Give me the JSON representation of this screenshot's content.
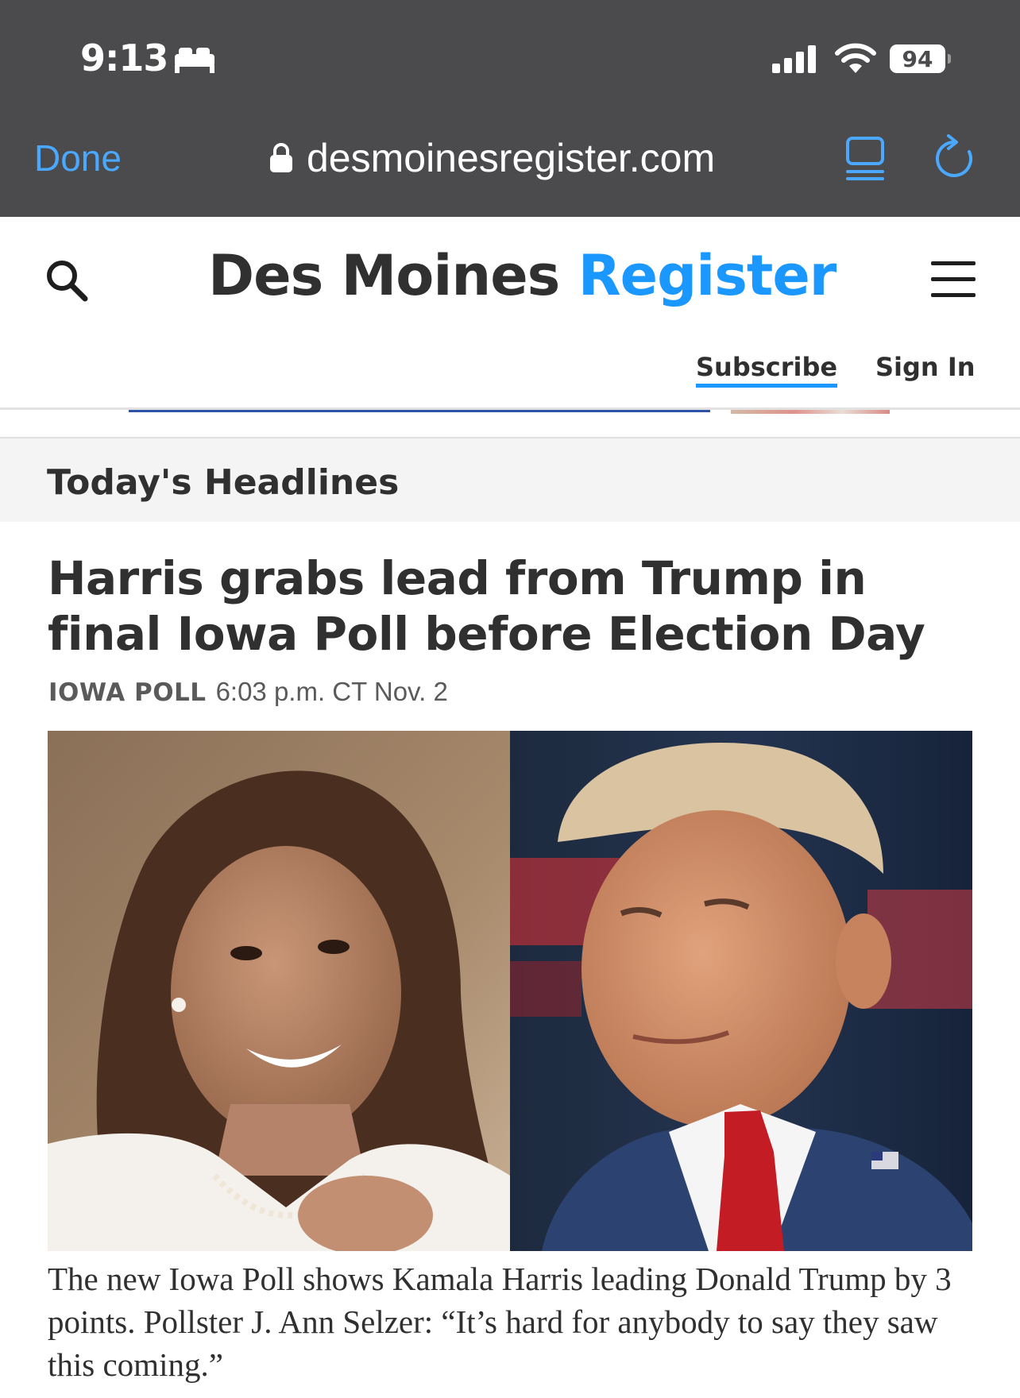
{
  "status_bar": {
    "time": "9:13",
    "battery": "94",
    "icons": [
      "bed-icon",
      "signal-bars-icon",
      "wifi-icon",
      "battery-icon"
    ]
  },
  "browser": {
    "done_label": "Done",
    "url": "desmoinesregister.com",
    "icons": [
      "lock-icon",
      "reader-icon",
      "reload-icon"
    ],
    "accent_color": "#4aa8ff"
  },
  "site": {
    "logo_part1": "Des Moines",
    "logo_part2": "Register",
    "subscribe_label": "Subscribe",
    "signin_label": "Sign In",
    "brand_color": "#1a98ff",
    "icons": [
      "search-icon",
      "hamburger-menu-icon"
    ]
  },
  "section": {
    "title": "Today's Headlines"
  },
  "article": {
    "headline": "Harris grabs lead from Trump in final Iowa Poll before Election Day",
    "label": "IOWA POLL",
    "timestamp": "6:03 p.m. CT Nov. 2",
    "summary": "The new Iowa Poll shows Kamala Harris leading Donald Trump by 3 points. Pollster J. Ann Selzer: “It’s hard for anybody to say they saw this coming.”"
  }
}
